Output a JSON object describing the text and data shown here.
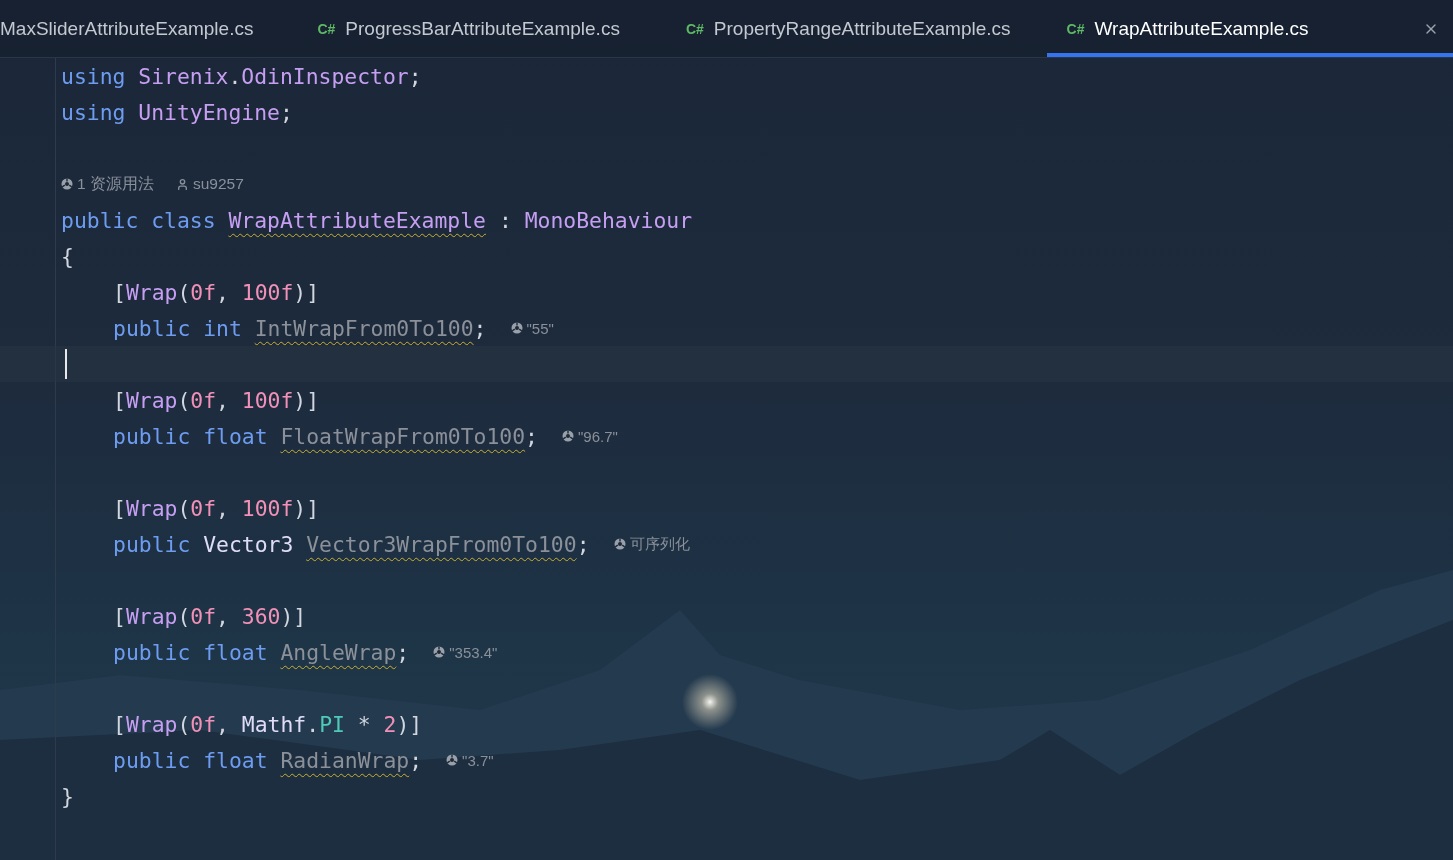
{
  "tabs": [
    {
      "label": "MaxSliderAttributeExample.cs",
      "selected": false
    },
    {
      "icon": "C#",
      "label": "ProgressBarAttributeExample.cs",
      "selected": false
    },
    {
      "icon": "C#",
      "label": "PropertyRangeAttributeExample.cs",
      "selected": false
    },
    {
      "icon": "C#",
      "label": "WrapAttributeExample.cs",
      "selected": true
    }
  ],
  "editor": {
    "lines": [
      {
        "kind": "code",
        "tokens": [
          {
            "kind": "kw",
            "text": "using "
          },
          {
            "kind": "cls",
            "text": "Sirenix"
          },
          {
            "kind": "plain",
            "text": "."
          },
          {
            "kind": "cls",
            "text": "OdinInspector"
          },
          {
            "kind": "plain",
            "text": ";"
          }
        ]
      },
      {
        "kind": "code",
        "tokens": [
          {
            "kind": "kw",
            "text": "using "
          },
          {
            "kind": "cls",
            "text": "UnityEngine"
          },
          {
            "kind": "plain",
            "text": ";"
          }
        ]
      },
      {
        "kind": "blank"
      },
      {
        "kind": "lens",
        "items": [
          {
            "kind": "usages",
            "text": "1 资源用法"
          },
          {
            "kind": "author",
            "text": "su9257"
          }
        ]
      },
      {
        "kind": "code",
        "tokens": [
          {
            "kind": "kw",
            "text": "public class "
          },
          {
            "kind": "decl",
            "text": "WrapAttributeExample"
          },
          {
            "kind": "plain",
            "text": " : "
          },
          {
            "kind": "cls",
            "text": "MonoBehaviour"
          }
        ]
      },
      {
        "kind": "code",
        "tokens": [
          {
            "kind": "plain",
            "text": "{"
          }
        ]
      },
      {
        "kind": "block",
        "children": [
          {
            "kind": "code",
            "tokens": [
              {
                "kind": "plain",
                "text": "["
              },
              {
                "kind": "attr",
                "text": "Wrap"
              },
              {
                "kind": "plain",
                "text": "("
              },
              {
                "kind": "num",
                "text": "0f"
              },
              {
                "kind": "plain",
                "text": ", "
              },
              {
                "kind": "num",
                "text": "100f"
              },
              {
                "kind": "plain",
                "text": ")]"
              }
            ]
          },
          {
            "kind": "code",
            "tokens": [
              {
                "kind": "kw",
                "text": "public int "
              },
              {
                "kind": "field",
                "text": "IntWrapFrom0To100"
              },
              {
                "kind": "plain",
                "text": ";"
              }
            ],
            "hint": "\"55\""
          },
          {
            "kind": "cursor"
          },
          {
            "kind": "code",
            "tokens": [
              {
                "kind": "plain",
                "text": "["
              },
              {
                "kind": "attr",
                "text": "Wrap"
              },
              {
                "kind": "plain",
                "text": "("
              },
              {
                "kind": "num",
                "text": "0f"
              },
              {
                "kind": "plain",
                "text": ", "
              },
              {
                "kind": "num",
                "text": "100f"
              },
              {
                "kind": "plain",
                "text": ")]"
              }
            ]
          },
          {
            "kind": "code",
            "tokens": [
              {
                "kind": "kw",
                "text": "public float "
              },
              {
                "kind": "field",
                "text": "FloatWrapFrom0To100"
              },
              {
                "kind": "plain",
                "text": ";"
              }
            ],
            "hint": "\"96.7\""
          },
          {
            "kind": "blank"
          },
          {
            "kind": "code",
            "tokens": [
              {
                "kind": "plain",
                "text": "["
              },
              {
                "kind": "attr",
                "text": "Wrap"
              },
              {
                "kind": "plain",
                "text": "("
              },
              {
                "kind": "num",
                "text": "0f"
              },
              {
                "kind": "plain",
                "text": ", "
              },
              {
                "kind": "num",
                "text": "100f"
              },
              {
                "kind": "plain",
                "text": ")]"
              }
            ]
          },
          {
            "kind": "code",
            "tokens": [
              {
                "kind": "kw",
                "text": "public "
              },
              {
                "kind": "type",
                "text": "Vector3 "
              },
              {
                "kind": "field",
                "text": "Vector3WrapFrom0To100"
              },
              {
                "kind": "plain",
                "text": ";"
              }
            ],
            "hint": "可序列化"
          },
          {
            "kind": "blank"
          },
          {
            "kind": "code",
            "tokens": [
              {
                "kind": "plain",
                "text": "["
              },
              {
                "kind": "attr",
                "text": "Wrap"
              },
              {
                "kind": "plain",
                "text": "("
              },
              {
                "kind": "num",
                "text": "0f"
              },
              {
                "kind": "plain",
                "text": ", "
              },
              {
                "kind": "num",
                "text": "360"
              },
              {
                "kind": "plain",
                "text": ")]"
              }
            ]
          },
          {
            "kind": "code",
            "tokens": [
              {
                "kind": "kw",
                "text": "public float "
              },
              {
                "kind": "field",
                "text": "AngleWrap"
              },
              {
                "kind": "plain",
                "text": ";"
              }
            ],
            "hint": "\"353.4\""
          },
          {
            "kind": "blank"
          },
          {
            "kind": "code",
            "tokens": [
              {
                "kind": "plain",
                "text": "["
              },
              {
                "kind": "attr",
                "text": "Wrap"
              },
              {
                "kind": "plain",
                "text": "("
              },
              {
                "kind": "num",
                "text": "0f"
              },
              {
                "kind": "plain",
                "text": ", "
              },
              {
                "kind": "type",
                "text": "Mathf"
              },
              {
                "kind": "plain",
                "text": "."
              },
              {
                "kind": "const",
                "text": "PI"
              },
              {
                "kind": "plain",
                "text": " * "
              },
              {
                "kind": "num",
                "text": "2"
              },
              {
                "kind": "plain",
                "text": ")]"
              }
            ]
          },
          {
            "kind": "code",
            "tokens": [
              {
                "kind": "kw",
                "text": "public float "
              },
              {
                "kind": "field",
                "text": "RadianWrap"
              },
              {
                "kind": "plain",
                "text": ";"
              }
            ],
            "hint": "\"3.7\""
          }
        ]
      },
      {
        "kind": "code",
        "tokens": [
          {
            "kind": "plain",
            "text": "}"
          }
        ]
      }
    ]
  }
}
